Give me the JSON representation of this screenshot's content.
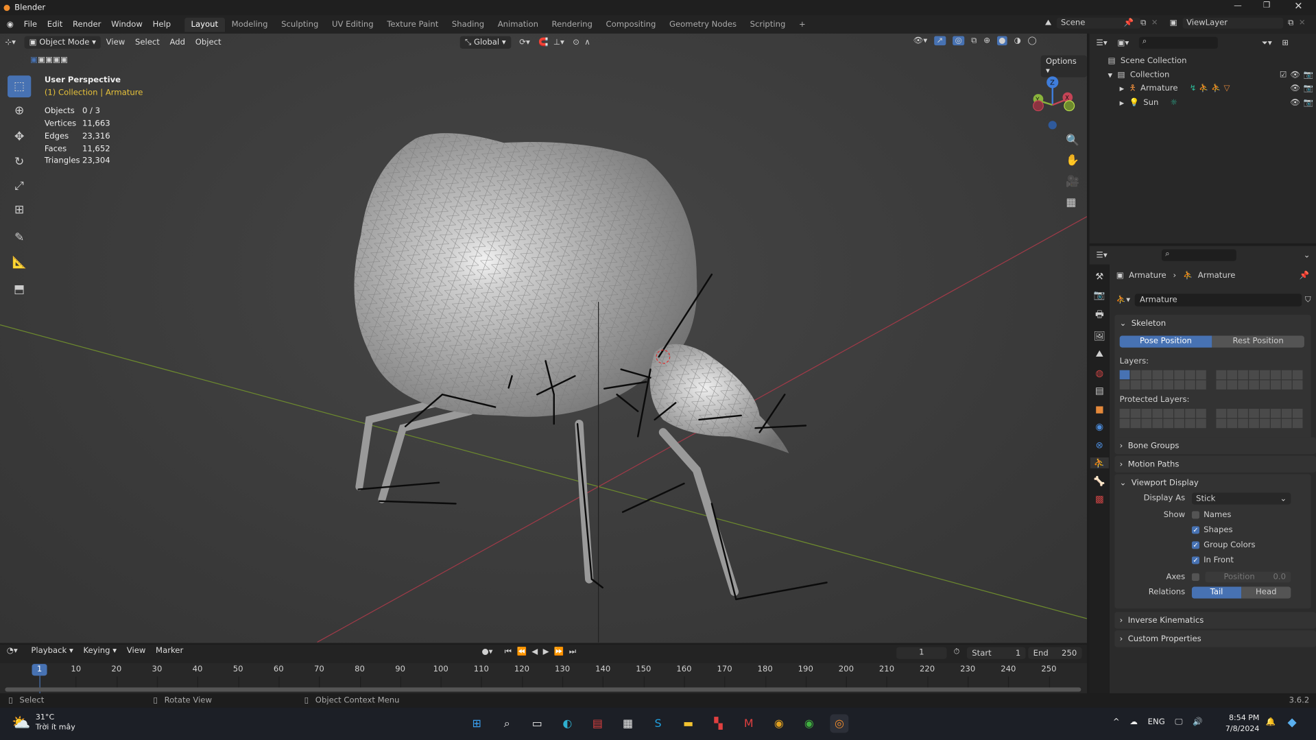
{
  "title_bar": {
    "app_name": "Blender"
  },
  "menu": {
    "items": [
      "File",
      "Edit",
      "Render",
      "Window",
      "Help"
    ],
    "workspaces": [
      "Layout",
      "Modeling",
      "Sculpting",
      "UV Editing",
      "Texture Paint",
      "Shading",
      "Animation",
      "Rendering",
      "Compositing",
      "Geometry Nodes",
      "Scripting"
    ],
    "active_workspace": "Layout",
    "add_workspace": "+"
  },
  "scene_selector": {
    "scene": "Scene",
    "view_layer": "ViewLayer"
  },
  "viewport_header": {
    "mode": "Object Mode",
    "menus": [
      "View",
      "Select",
      "Add",
      "Object"
    ],
    "orientation": "Global",
    "options": "Options"
  },
  "overlay": {
    "view_name": "User Perspective",
    "context": "(1) Collection | Armature",
    "stats": [
      {
        "label": "Objects",
        "value": "0 / 3"
      },
      {
        "label": "Vertices",
        "value": "11,663"
      },
      {
        "label": "Edges",
        "value": "23,316"
      },
      {
        "label": "Faces",
        "value": "11,652"
      },
      {
        "label": "Triangles",
        "value": "23,304"
      }
    ]
  },
  "gizmo": {
    "z": "Z",
    "y": "Y",
    "x": "X"
  },
  "outliner": {
    "root": "Scene Collection",
    "collection": "Collection",
    "items": [
      {
        "name": "Armature"
      },
      {
        "name": "Sun"
      }
    ]
  },
  "properties": {
    "breadcrumb_object": "Armature",
    "breadcrumb_data": "Armature",
    "data_name": "Armature",
    "skeleton": {
      "title": "Skeleton",
      "pose": "Pose Position",
      "rest": "Rest Position",
      "layers": "Layers:",
      "protected": "Protected Layers:"
    },
    "collapsed_1": [
      "Bone Groups",
      "Motion Paths"
    ],
    "viewport_display": {
      "title": "Viewport Display",
      "display_as_label": "Display As",
      "display_as": "Stick",
      "show_label": "Show",
      "names": "Names",
      "names_checked": false,
      "shapes": "Shapes",
      "shapes_checked": true,
      "group_colors": "Group Colors",
      "group_colors_checked": true,
      "in_front": "In Front",
      "in_front_checked": true,
      "axes_label": "Axes",
      "axes_position": "Position",
      "axes_value": "0.0",
      "relations_label": "Relations",
      "tail": "Tail",
      "head": "Head"
    },
    "collapsed_2": [
      "Inverse Kinematics",
      "Custom Properties"
    ]
  },
  "timeline": {
    "menus": [
      "Playback",
      "Keying",
      "View",
      "Marker"
    ],
    "current_frame": "1",
    "start_label": "Start",
    "start": "1",
    "end_label": "End",
    "end": "250",
    "ticks": [
      "10",
      "20",
      "30",
      "40",
      "50",
      "60",
      "70",
      "80",
      "90",
      "100",
      "110",
      "120",
      "130",
      "140",
      "150",
      "160",
      "170",
      "180",
      "190",
      "200",
      "210",
      "220",
      "230",
      "240",
      "250"
    ]
  },
  "status_bar": {
    "select": "Select",
    "rotate": "Rotate View",
    "context_menu": "Object Context Menu",
    "version": "3.6.2"
  },
  "taskbar": {
    "temperature": "31°C",
    "weather": "Trời ít mây",
    "language": "ENG",
    "time": "8:54 PM",
    "date": "7/8/2024"
  },
  "colors": {
    "accent": "#4772b3",
    "x_axis": "#c44456",
    "y_axis": "#8ab43c",
    "z_axis": "#3f7ddb",
    "active_tab": "#303030"
  }
}
